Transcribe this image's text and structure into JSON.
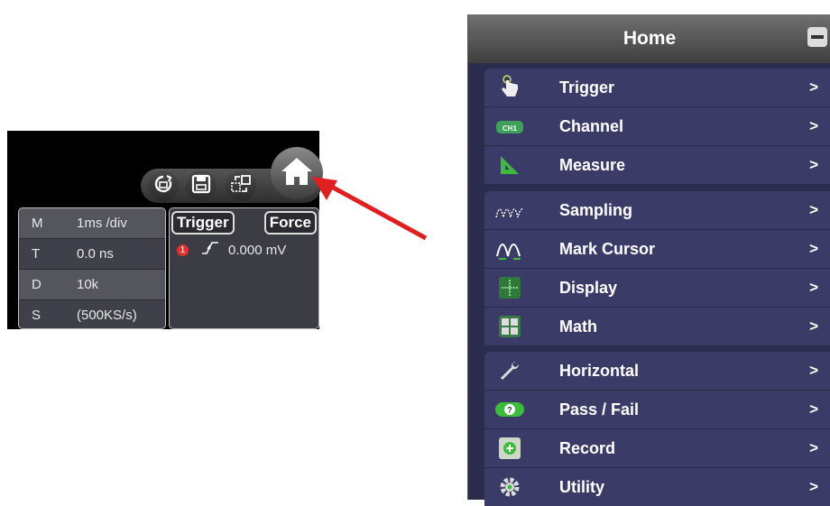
{
  "scope": {
    "toolbar": {
      "icons": [
        "refresh-icon",
        "save-icon",
        "swap-icon",
        "home-icon"
      ]
    },
    "info": [
      {
        "key": "M",
        "value": "1ms /div"
      },
      {
        "key": "T",
        "value": "0.0 ns"
      },
      {
        "key": "D",
        "value": "10k"
      },
      {
        "key": "S",
        "value": "(500KS/s)"
      }
    ],
    "trigger_button": "Trigger",
    "force_button": "Force",
    "trigger_channel": "1",
    "trigger_level": "0.000 mV"
  },
  "menu": {
    "title": "Home",
    "items": [
      {
        "label": "Trigger",
        "arrow": ">",
        "icon": "hand-pointer-icon"
      },
      {
        "label": "Channel",
        "arrow": ">",
        "icon": "ch1-icon"
      },
      {
        "label": "Measure",
        "arrow": ">",
        "icon": "triangle-ruler-icon"
      },
      {
        "label": "Sampling",
        "arrow": ">",
        "icon": "waveform-icon"
      },
      {
        "label": "Mark Cursor",
        "arrow": ">",
        "icon": "cursor-wave-icon"
      },
      {
        "label": "Display",
        "arrow": ">",
        "icon": "crosshair-icon"
      },
      {
        "label": "Math",
        "arrow": ">",
        "icon": "calculator-icon"
      },
      {
        "label": "Horizontal",
        "arrow": ">",
        "icon": "wrench-icon"
      },
      {
        "label": "Pass / Fail",
        "arrow": ">",
        "icon": "pass-fail-icon"
      },
      {
        "label": "Record",
        "arrow": ">",
        "icon": "record-icon"
      },
      {
        "label": "Utility",
        "arrow": ">",
        "icon": "gear-icon"
      }
    ]
  },
  "colors": {
    "annotation_arrow": "#e02020",
    "menu_bg": "#2c2c4e",
    "group_bg": "#3b3b68"
  }
}
